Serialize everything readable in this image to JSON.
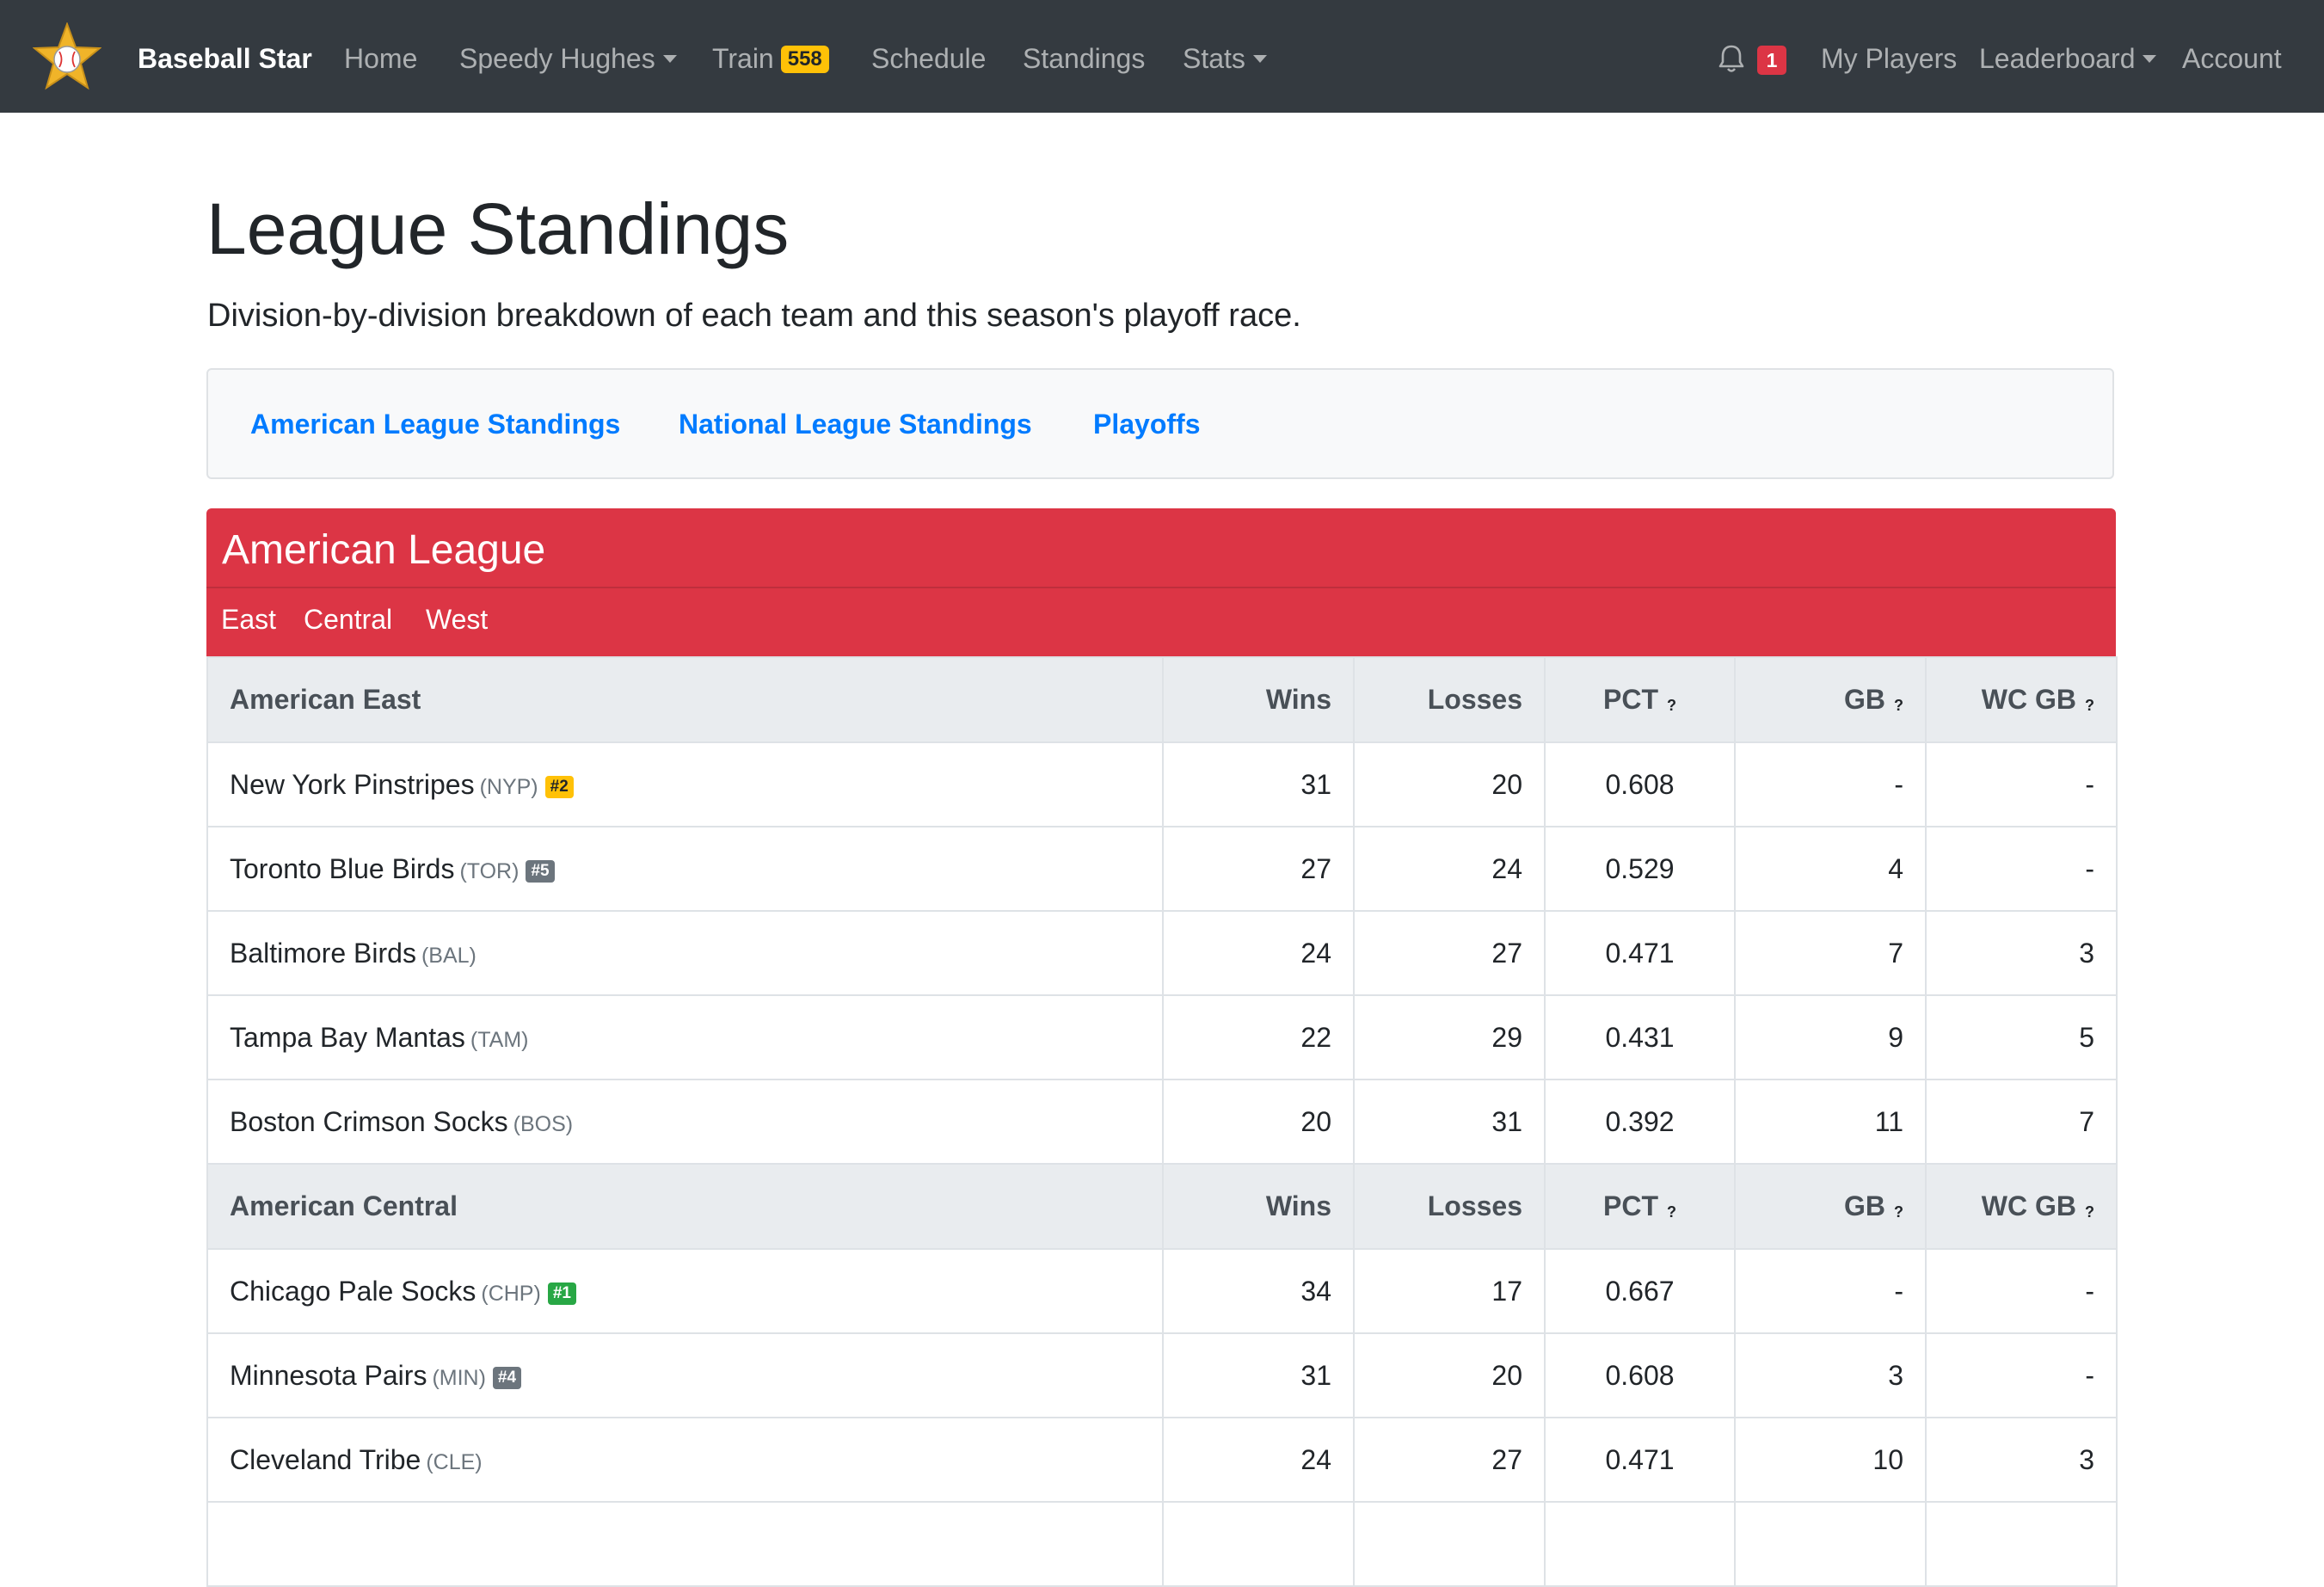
{
  "nav": {
    "brand": "Baseball Star",
    "home": "Home",
    "player": "Speedy Hughes",
    "train": "Train",
    "train_badge": "558",
    "schedule": "Schedule",
    "standings": "Standings",
    "stats": "Stats",
    "notifications": "1",
    "my_players": "My Players",
    "leaderboard": "Leaderboard",
    "account": "Account",
    "icons": {
      "logo": "baseball-star-logo",
      "bell": "bell-icon"
    }
  },
  "page": {
    "title": "League Standings",
    "lead": "Division-by-division breakdown of each team and this season's playoff race."
  },
  "subnav": [
    "American League Standings",
    "National League Standings",
    "Playoffs"
  ],
  "league": {
    "title": "American League",
    "divisions": [
      "East",
      "Central",
      "West"
    ]
  },
  "table": {
    "columns": [
      "Wins",
      "Losses",
      "PCT",
      "GB",
      "WC GB"
    ],
    "help_glyph": "?",
    "groups": [
      {
        "name": "American East",
        "teams": [
          {
            "name": "New York Pinstripes",
            "abbr": "(NYP)",
            "seed": "#2",
            "wins": "31",
            "losses": "20",
            "pct": "0.608",
            "gb": "-",
            "wcgb": "-"
          },
          {
            "name": "Toronto Blue Birds",
            "abbr": "(TOR)",
            "seed": "#5",
            "wins": "27",
            "losses": "24",
            "pct": "0.529",
            "gb": "4",
            "wcgb": "-"
          },
          {
            "name": "Baltimore Birds",
            "abbr": "(BAL)",
            "wins": "24",
            "losses": "27",
            "pct": "0.471",
            "gb": "7",
            "wcgb": "3"
          },
          {
            "name": "Tampa Bay Mantas",
            "abbr": "(TAM)",
            "wins": "22",
            "losses": "29",
            "pct": "0.431",
            "gb": "9",
            "wcgb": "5"
          },
          {
            "name": "Boston Crimson Socks",
            "abbr": "(BOS)",
            "wins": "20",
            "losses": "31",
            "pct": "0.392",
            "gb": "11",
            "wcgb": "7"
          }
        ]
      },
      {
        "name": "American Central",
        "teams": [
          {
            "name": "Chicago Pale Socks",
            "abbr": "(CHP)",
            "seed": "#1",
            "wins": "34",
            "losses": "17",
            "pct": "0.667",
            "gb": "-",
            "wcgb": "-"
          },
          {
            "name": "Minnesota Pairs",
            "abbr": "(MIN)",
            "seed": "#4",
            "wins": "31",
            "losses": "20",
            "pct": "0.608",
            "gb": "3",
            "wcgb": "-"
          },
          {
            "name": "Cleveland Tribe",
            "abbr": "(CLE)",
            "wins": "24",
            "losses": "27",
            "pct": "0.471",
            "gb": "10",
            "wcgb": "3"
          },
          {
            "name": "",
            "abbr": "",
            "wins": "",
            "losses": "",
            "pct": "",
            "gb": "",
            "wcgb": ""
          }
        ]
      }
    ]
  },
  "colors": {
    "navbar": "#343a40",
    "league_header": "#dc3545",
    "link": "#007bff",
    "seed_gold": "#ffc107",
    "seed_grey": "#6c757d",
    "seed_green": "#28a745",
    "notification": "#dc3545"
  }
}
